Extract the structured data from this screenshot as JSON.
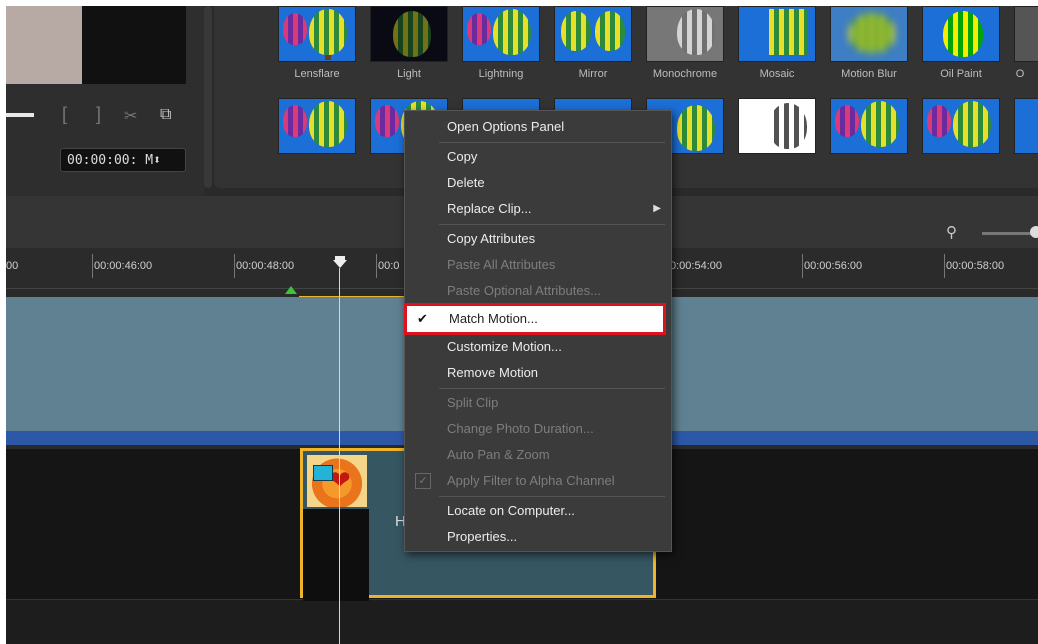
{
  "preview": {
    "timecode": "00:00:00: M⬍",
    "mark_in": "[",
    "mark_out": "]"
  },
  "effects": {
    "row1": [
      "Lensflare",
      "Light",
      "Lightning",
      "Mirror",
      "Monochrome",
      "Mosaic",
      "Motion Blur",
      "Oil Paint",
      "O"
    ]
  },
  "ruler": {
    "ticks": [
      "00",
      "00:00:46:00",
      "00:00:48:00",
      "00:0",
      "0:00:54:00",
      "00:00:56:00",
      "00:00:58:00"
    ]
  },
  "clip": {
    "letter": "H"
  },
  "menu": {
    "items": [
      {
        "label": "Open Options Panel",
        "enabled": true
      },
      {
        "label": "Copy",
        "enabled": true
      },
      {
        "label": "Delete",
        "enabled": true
      },
      {
        "label": "Replace Clip...",
        "enabled": true,
        "submenu": true
      },
      {
        "label": "Copy Attributes",
        "enabled": true
      },
      {
        "label": "Paste All Attributes",
        "enabled": false
      },
      {
        "label": "Paste Optional Attributes...",
        "enabled": false
      },
      {
        "label": "Match Motion...",
        "enabled": true,
        "checked": true,
        "highlighted": true
      },
      {
        "label": "Customize Motion...",
        "enabled": true
      },
      {
        "label": "Remove Motion",
        "enabled": true
      },
      {
        "label": "Split Clip",
        "enabled": false
      },
      {
        "label": "Change Photo Duration...",
        "enabled": false
      },
      {
        "label": "Auto Pan & Zoom",
        "enabled": false
      },
      {
        "label": "Apply Filter to Alpha Channel",
        "enabled": false,
        "checkbox": true
      },
      {
        "label": "Locate on Computer...",
        "enabled": true
      },
      {
        "label": "Properties...",
        "enabled": true
      }
    ]
  },
  "colors": {
    "highlight_border": "#d9141e",
    "clip_border": "#f0b428",
    "track_blue": "#2d58a8"
  }
}
